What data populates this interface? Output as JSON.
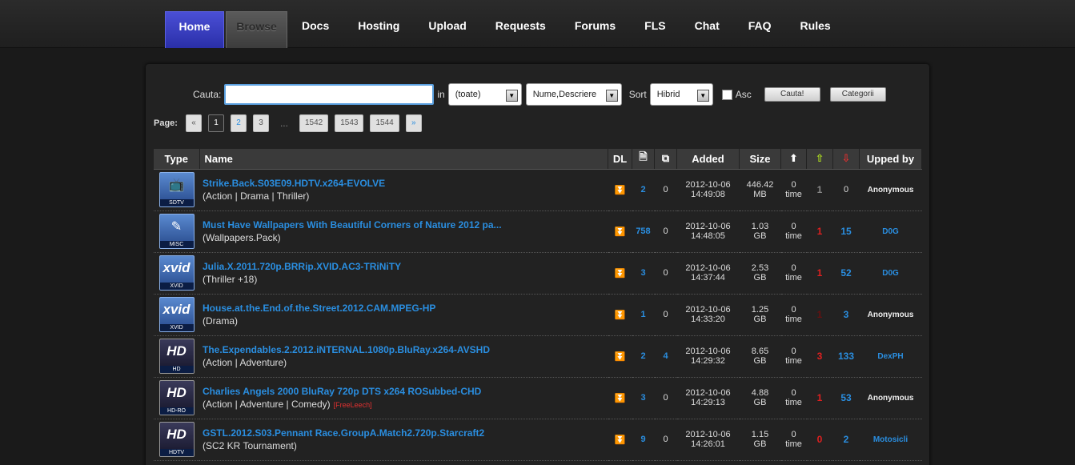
{
  "nav": {
    "items": [
      {
        "label": "Home",
        "name": "nav-home"
      },
      {
        "label": "Browse",
        "name": "nav-browse"
      },
      {
        "label": "Docs",
        "name": "nav-docs"
      },
      {
        "label": "Hosting",
        "name": "nav-hosting"
      },
      {
        "label": "Upload",
        "name": "nav-upload"
      },
      {
        "label": "Requests",
        "name": "nav-requests"
      },
      {
        "label": "Forums",
        "name": "nav-forums"
      },
      {
        "label": "FLS",
        "name": "nav-fls"
      },
      {
        "label": "Chat",
        "name": "nav-chat"
      },
      {
        "label": "FAQ",
        "name": "nav-faq"
      },
      {
        "label": "Rules",
        "name": "nav-rules"
      }
    ]
  },
  "search": {
    "label": "Cauta:",
    "value": "",
    "in_label": "in",
    "category_select": "(toate)",
    "field_select": "Nume,Descriere",
    "sort_label": "Sort",
    "sort_select": "Hibrid",
    "asc_label": "Asc",
    "search_button": "Cauta!",
    "categories_button": "Categorii"
  },
  "pager": {
    "label": "Page:",
    "prev": "«",
    "pages": [
      "1",
      "2",
      "3"
    ],
    "dots": "...",
    "last_pages": [
      "1542",
      "1543",
      "1544"
    ],
    "next": "»"
  },
  "table": {
    "headers": {
      "type": "Type",
      "name": "Name",
      "dl": "DL",
      "added": "Added",
      "size": "Size",
      "upped_by": "Upped by"
    },
    "rows": [
      {
        "cat": "SDTV",
        "glyph": "📺",
        "title": "Strike.Back.S03E09.HDTV.x264-EVOLVE",
        "genre": "(Action | Drama | Thriller)",
        "freeleech": "",
        "files": "2",
        "comments": "0",
        "date": "2012-10-06",
        "time": "14:49:08",
        "size_val": "446.42",
        "size_unit": "MB",
        "snatched": "0",
        "snatched_unit": "time",
        "seeders": "1",
        "leechers": "0",
        "upper": "Anonymous"
      },
      {
        "cat": "MISC",
        "glyph": "✎",
        "title": "Must Have Wallpapers With Beautiful Corners of Nature 2012 pa...",
        "genre": "(Wallpapers.Pack)",
        "freeleech": "",
        "files": "758",
        "comments": "0",
        "date": "2012-10-06",
        "time": "14:48:05",
        "size_val": "1.03",
        "size_unit": "GB",
        "snatched": "0",
        "snatched_unit": "time",
        "seeders": "1",
        "leechers": "15",
        "upper": "D0G"
      },
      {
        "cat": "XVID",
        "glyph": "xvid",
        "title": "Julia.X.2011.720p.BRRip.XVID.AC3-TRiNiTY",
        "genre": "(Thriller +18)",
        "freeleech": "",
        "files": "3",
        "comments": "0",
        "date": "2012-10-06",
        "time": "14:37:44",
        "size_val": "2.53",
        "size_unit": "GB",
        "snatched": "0",
        "snatched_unit": "time",
        "seeders": "1",
        "leechers": "52",
        "upper": "D0G"
      },
      {
        "cat": "XVID",
        "glyph": "xvid",
        "title": "House.at.the.End.of.the.Street.2012.CAM.MPEG-HP",
        "genre": "(Drama)",
        "freeleech": "",
        "files": "1",
        "comments": "0",
        "date": "2012-10-06",
        "time": "14:33:20",
        "size_val": "1.25",
        "size_unit": "GB",
        "snatched": "0",
        "snatched_unit": "time",
        "seeders": "1",
        "leechers": "3",
        "upper": "Anonymous"
      },
      {
        "cat": "HD",
        "glyph": "HD",
        "title": "The.Expendables.2.2012.iNTERNAL.1080p.BluRay.x264-AVSHD",
        "genre": "(Action | Adventure)",
        "freeleech": "",
        "files": "2",
        "comments": "4",
        "date": "2012-10-06",
        "time": "14:29:32",
        "size_val": "8.65",
        "size_unit": "GB",
        "snatched": "0",
        "snatched_unit": "time",
        "seeders": "3",
        "leechers": "133",
        "upper": "DexPH"
      },
      {
        "cat": "HD-RO",
        "glyph": "HD",
        "title": "Charlies Angels 2000 BluRay 720p DTS x264 ROSubbed-CHD",
        "genre": "(Action | Adventure | Comedy)",
        "freeleech": "[FreeLeech]",
        "files": "3",
        "comments": "0",
        "date": "2012-10-06",
        "time": "14:29:13",
        "size_val": "4.88",
        "size_unit": "GB",
        "snatched": "0",
        "snatched_unit": "time",
        "seeders": "1",
        "leechers": "53",
        "upper": "Anonymous"
      },
      {
        "cat": "HDTV",
        "glyph": "HD",
        "title": "GSTL.2012.S03.Pennant Race.GroupA.Match2.720p.Starcraft2",
        "genre": "(SC2 KR Tournament)",
        "freeleech": "",
        "files": "9",
        "comments": "0",
        "date": "2012-10-06",
        "time": "14:26:01",
        "size_val": "1.15",
        "size_unit": "GB",
        "snatched": "0",
        "snatched_unit": "time",
        "seeders": "0",
        "leechers": "2",
        "upper": "Motosicli"
      }
    ]
  }
}
